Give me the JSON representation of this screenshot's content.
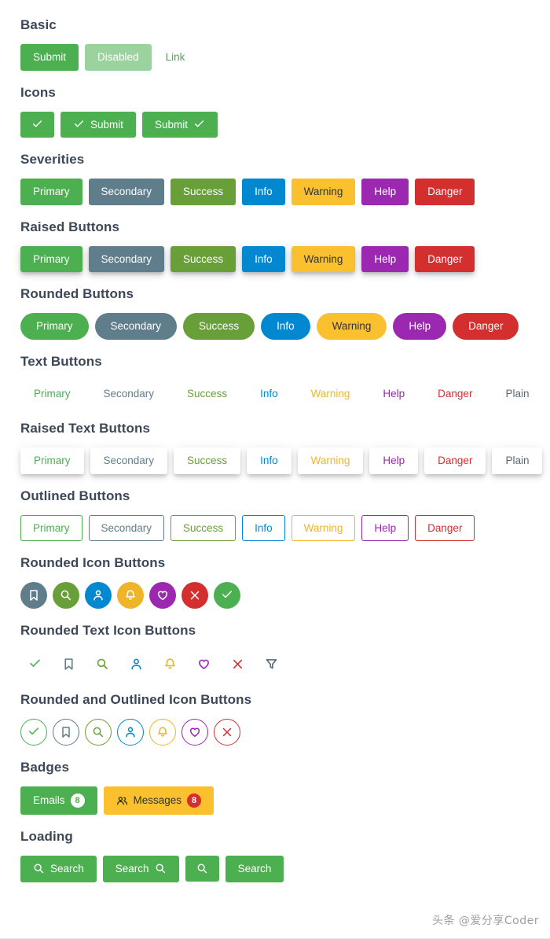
{
  "colors": {
    "primary": "#4caf50",
    "primary_disabled": "#8bd18e",
    "secondary": "#607d8b",
    "success": "#689f38",
    "info": "#0288d1",
    "warning": "#fbc02d",
    "help": "#9c27b0",
    "danger": "#d32f2f",
    "plain": "#5a6876",
    "link": "#5f9b5f",
    "heading": "#3c4858",
    "warning_text": "#f0b429",
    "badge_red": "#d32f2f",
    "watermark": "#9e9e9e"
  },
  "sections": {
    "basic": {
      "title": "Basic",
      "submit": "Submit",
      "disabled": "Disabled",
      "link": "Link"
    },
    "icons": {
      "title": "Icons",
      "icon_only_name": "check-icon",
      "left_label": "Submit",
      "right_label": "Submit"
    },
    "severities": {
      "title": "Severities",
      "items": [
        {
          "label": "Primary",
          "severity": "primary"
        },
        {
          "label": "Secondary",
          "severity": "secondary"
        },
        {
          "label": "Success",
          "severity": "success"
        },
        {
          "label": "Info",
          "severity": "info"
        },
        {
          "label": "Warning",
          "severity": "warning"
        },
        {
          "label": "Help",
          "severity": "help"
        },
        {
          "label": "Danger",
          "severity": "danger"
        }
      ]
    },
    "raised": {
      "title": "Raised Buttons",
      "items": [
        {
          "label": "Primary"
        },
        {
          "label": "Secondary"
        },
        {
          "label": "Success"
        },
        {
          "label": "Info"
        },
        {
          "label": "Warning"
        },
        {
          "label": "Help"
        },
        {
          "label": "Danger"
        }
      ]
    },
    "rounded": {
      "title": "Rounded Buttons",
      "items": [
        {
          "label": "Primary"
        },
        {
          "label": "Secondary"
        },
        {
          "label": "Success"
        },
        {
          "label": "Info"
        },
        {
          "label": "Warning"
        },
        {
          "label": "Help"
        },
        {
          "label": "Danger"
        }
      ]
    },
    "text_buttons": {
      "title": "Text Buttons",
      "items": [
        {
          "label": "Primary"
        },
        {
          "label": "Secondary"
        },
        {
          "label": "Success"
        },
        {
          "label": "Info"
        },
        {
          "label": "Warning"
        },
        {
          "label": "Help"
        },
        {
          "label": "Danger"
        },
        {
          "label": "Plain"
        }
      ]
    },
    "raised_text": {
      "title": "Raised Text Buttons",
      "items": [
        {
          "label": "Primary"
        },
        {
          "label": "Secondary"
        },
        {
          "label": "Success"
        },
        {
          "label": "Info"
        },
        {
          "label": "Warning"
        },
        {
          "label": "Help"
        },
        {
          "label": "Danger"
        },
        {
          "label": "Plain"
        }
      ]
    },
    "outlined": {
      "title": "Outlined Buttons",
      "items": [
        {
          "label": "Primary"
        },
        {
          "label": "Secondary"
        },
        {
          "label": "Success"
        },
        {
          "label": "Info"
        },
        {
          "label": "Warning"
        },
        {
          "label": "Help"
        },
        {
          "label": "Danger"
        }
      ]
    },
    "rounded_icons": {
      "title": "Rounded Icon Buttons",
      "items": [
        {
          "icon": "bookmark-icon",
          "severity": "secondary"
        },
        {
          "icon": "search-icon",
          "severity": "success"
        },
        {
          "icon": "user-icon",
          "severity": "info"
        },
        {
          "icon": "bell-icon",
          "severity": "warning"
        },
        {
          "icon": "heart-icon",
          "severity": "help"
        },
        {
          "icon": "times-icon",
          "severity": "danger"
        },
        {
          "icon": "check-icon",
          "severity": "primary"
        }
      ]
    },
    "rounded_text_icons": {
      "title": "Rounded Text Icon Buttons",
      "items": [
        {
          "icon": "check-icon",
          "severity": "primary"
        },
        {
          "icon": "bookmark-icon",
          "severity": "secondary"
        },
        {
          "icon": "search-icon",
          "severity": "success"
        },
        {
          "icon": "user-icon",
          "severity": "info"
        },
        {
          "icon": "bell-icon",
          "severity": "warning"
        },
        {
          "icon": "heart-icon",
          "severity": "help"
        },
        {
          "icon": "times-icon",
          "severity": "danger"
        },
        {
          "icon": "filter-icon",
          "severity": "plain"
        }
      ]
    },
    "rounded_outlined_icons": {
      "title": "Rounded and Outlined Icon Buttons",
      "items": [
        {
          "icon": "check-icon",
          "severity": "primary"
        },
        {
          "icon": "bookmark-icon",
          "severity": "secondary"
        },
        {
          "icon": "search-icon",
          "severity": "success"
        },
        {
          "icon": "user-icon",
          "severity": "info"
        },
        {
          "icon": "bell-icon",
          "severity": "warning"
        },
        {
          "icon": "heart-icon",
          "severity": "help"
        },
        {
          "icon": "times-icon",
          "severity": "danger"
        }
      ]
    },
    "badges": {
      "title": "Badges",
      "emails_label": "Emails",
      "emails_count": "8",
      "messages_label": "Messages",
      "messages_count": "8",
      "messages_icon": "users-icon"
    },
    "loading": {
      "title": "Loading",
      "items": [
        {
          "label": "Search",
          "icon_position": "left"
        },
        {
          "label": "Search",
          "icon_position": "right"
        },
        {
          "label": "",
          "icon_position": "only"
        },
        {
          "label": "Search",
          "icon_position": "none"
        }
      ]
    }
  },
  "watermark": "头条 @爱分享Coder"
}
